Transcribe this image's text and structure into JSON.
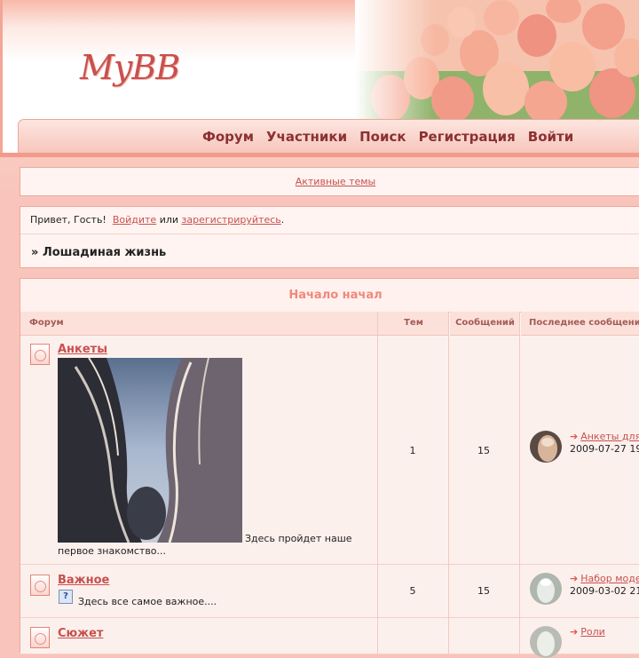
{
  "header": {
    "logo_text": "MyBB"
  },
  "nav": {
    "items": [
      "Форум",
      "Участники",
      "Поиск",
      "Регистрация",
      "Войти"
    ]
  },
  "active_topics_link": "Активные темы",
  "welcome": {
    "greeting": "Привет, Гость!",
    "login_link": "Войдите",
    "or_text": "или",
    "register_link": "зарегистрируйтесь",
    "period": "."
  },
  "breadcrumb": {
    "prefix": "»",
    "title": "Лошадиная жизнь"
  },
  "category": {
    "title": "Начало начал",
    "columns": {
      "forum": "Форум",
      "topics": "Тем",
      "posts": "Сообщений",
      "last_post": "Последнее сообщение"
    },
    "forums": [
      {
        "name": "Анкеты",
        "desc": "Здесь пройдет наше первое знакомство...",
        "topics": "1",
        "posts": "15",
        "last_topic": "Анкеты для",
        "last_date": "2009-07-27 19"
      },
      {
        "name": "Важное",
        "desc": "Здесь все самое важное....",
        "topics": "5",
        "posts": "15",
        "last_topic": "Набор моде",
        "last_date": "2009-03-02 21"
      },
      {
        "name": "Сюжет",
        "last_topic": "Роли"
      }
    ]
  },
  "colors": {
    "accent": "#c8504d",
    "nav_text": "#8c3131",
    "category_title": "#f0897c",
    "page_bg": "#f9c4bb"
  }
}
